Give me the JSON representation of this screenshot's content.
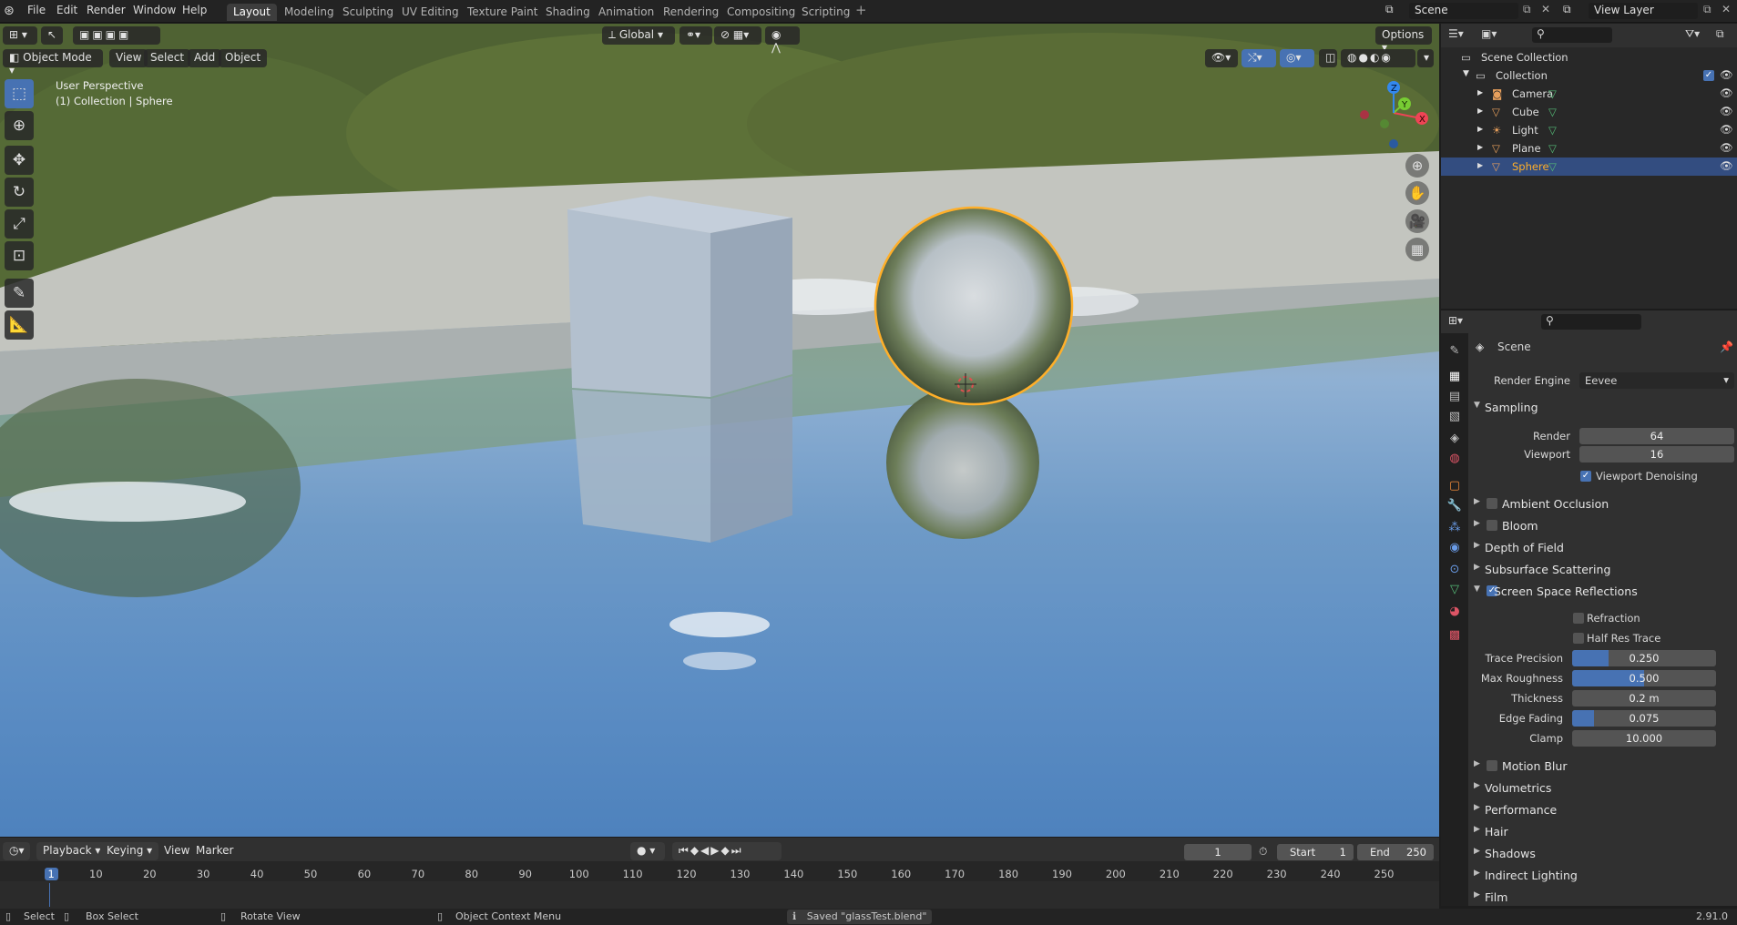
{
  "topbar": {
    "menus": [
      "File",
      "Edit",
      "Render",
      "Window",
      "Help"
    ],
    "workspaces": [
      "Layout",
      "Modeling",
      "Sculpting",
      "UV Editing",
      "Texture Paint",
      "Shading",
      "Animation",
      "Rendering",
      "Compositing",
      "Scripting"
    ],
    "active_workspace": "Layout",
    "scene": "Scene",
    "view_layer": "View Layer"
  },
  "viewport": {
    "transform_orientation": "Global",
    "options_label": "Options",
    "mode": "Object Mode",
    "menus": [
      "View",
      "Select",
      "Add",
      "Object"
    ],
    "info_line1": "User Perspective",
    "info_line2": "(1) Collection | Sphere",
    "gizmo": {
      "x": "X",
      "y": "Y",
      "z": "Z"
    }
  },
  "outliner": {
    "root": "Scene Collection",
    "collection": "Collection",
    "items": [
      {
        "label": "Camera",
        "icon": "camera-icon",
        "color": "#e8a05c"
      },
      {
        "label": "Cube",
        "icon": "mesh-icon",
        "color": "#e8a05c"
      },
      {
        "label": "Light",
        "icon": "light-icon",
        "color": "#e8a05c"
      },
      {
        "label": "Plane",
        "icon": "mesh-icon",
        "color": "#e8a05c"
      },
      {
        "label": "Sphere",
        "icon": "mesh-icon",
        "color": "#e8a05c"
      }
    ],
    "selected": "Sphere"
  },
  "properties": {
    "context": "Scene",
    "render_engine_label": "Render Engine",
    "render_engine": "Eevee",
    "sampling": {
      "title": "Sampling",
      "render_label": "Render",
      "render_value": "64",
      "viewport_label": "Viewport",
      "viewport_value": "16",
      "denoise_label": "Viewport Denoising"
    },
    "sections_top": [
      "Ambient Occlusion",
      "Bloom",
      "Depth of Field",
      "Subsurface Scattering"
    ],
    "ssr": {
      "title": "Screen Space Reflections",
      "refraction": "Refraction",
      "half_res": "Half Res Trace",
      "trace_precision_label": "Trace Precision",
      "trace_precision": "0.250",
      "trace_precision_fraction": 0.25,
      "max_roughness_label": "Max Roughness",
      "max_roughness": "0.500",
      "max_roughness_fraction": 0.5,
      "thickness_label": "Thickness",
      "thickness": "0.2 m",
      "edge_fading_label": "Edge Fading",
      "edge_fading": "0.075",
      "edge_fading_fraction": 0.15,
      "clamp_label": "Clamp",
      "clamp": "10.000"
    },
    "sections_bottom": [
      "Motion Blur",
      "Volumetrics",
      "Performance",
      "Hair",
      "Shadows",
      "Indirect Lighting",
      "Film"
    ]
  },
  "timeline": {
    "menus": [
      "Playback",
      "Keying",
      "View",
      "Marker"
    ],
    "current_frame": "1",
    "start_label": "Start",
    "start": "1",
    "end_label": "End",
    "end": "250",
    "ticks": [
      "1",
      "10",
      "20",
      "30",
      "40",
      "50",
      "60",
      "70",
      "80",
      "90",
      "100",
      "110",
      "120",
      "130",
      "140",
      "150",
      "160",
      "170",
      "180",
      "190",
      "200",
      "210",
      "220",
      "230",
      "240",
      "250"
    ]
  },
  "statusbar": {
    "select": "Select",
    "box_select": "Box Select",
    "rotate_view": "Rotate View",
    "context_menu": "Object Context Menu",
    "message": "Saved \"glassTest.blend\"",
    "version": "2.91.0"
  },
  "colors": {
    "accent": "#4772b3",
    "selection_outline": "#ffaf29"
  }
}
